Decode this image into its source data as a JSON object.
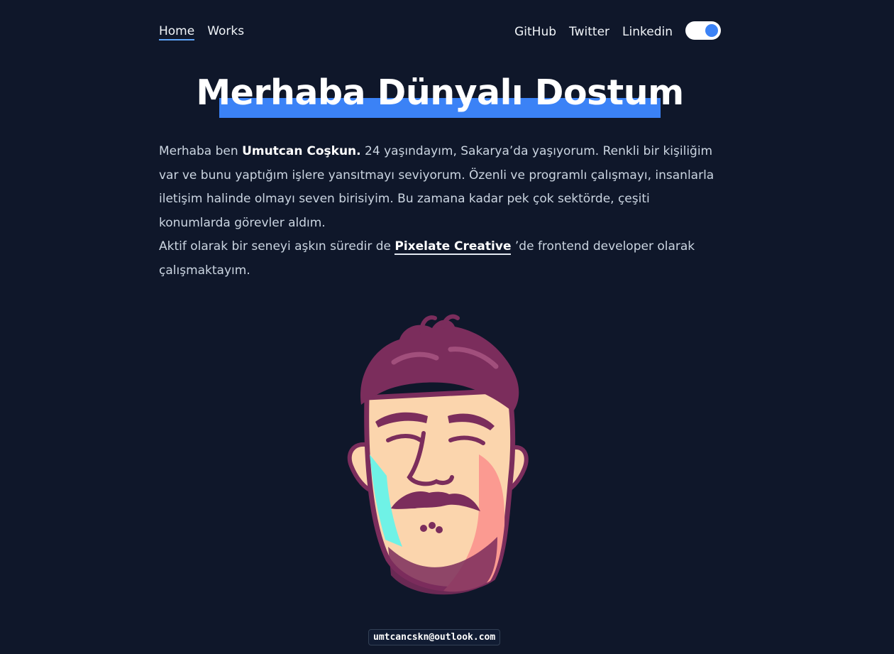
{
  "nav": {
    "home": "Home",
    "works": "Works",
    "github": "GitHub",
    "twitter": "Twitter",
    "linkedin": "Linkedin"
  },
  "theme_toggle": {
    "state": "on",
    "accent": "#3b82f6"
  },
  "hero": {
    "title": "Merhaba Dünyalı Dostum"
  },
  "bio": {
    "intro": "Merhaba ben ",
    "name": "Umutcan Coşkun.",
    "p1_rest": " 24 yaşındayım, Sakarya’da yaşıyorum. Renkli bir kişiliğim var ve bunu yaptığım işlere yansıtmayı seviyorum. Özenli ve programlı çalışmayı, insanlarla iletişim halinde olmayı seven birisiyim. Bu zamana kadar pek çok sektörde, çeşiti konumlarda görevler aldım.",
    "p2_start": "Aktif olarak bir seneyi aşkın süredir de ",
    "company": "Pixelate Creative",
    "p2_end": " ’de frontend developer olarak çalışmaktayım."
  },
  "footer": {
    "email": "umtcancskn@outlook.com"
  },
  "colors": {
    "background": "#0f172a",
    "highlight": "#3b82f6"
  }
}
